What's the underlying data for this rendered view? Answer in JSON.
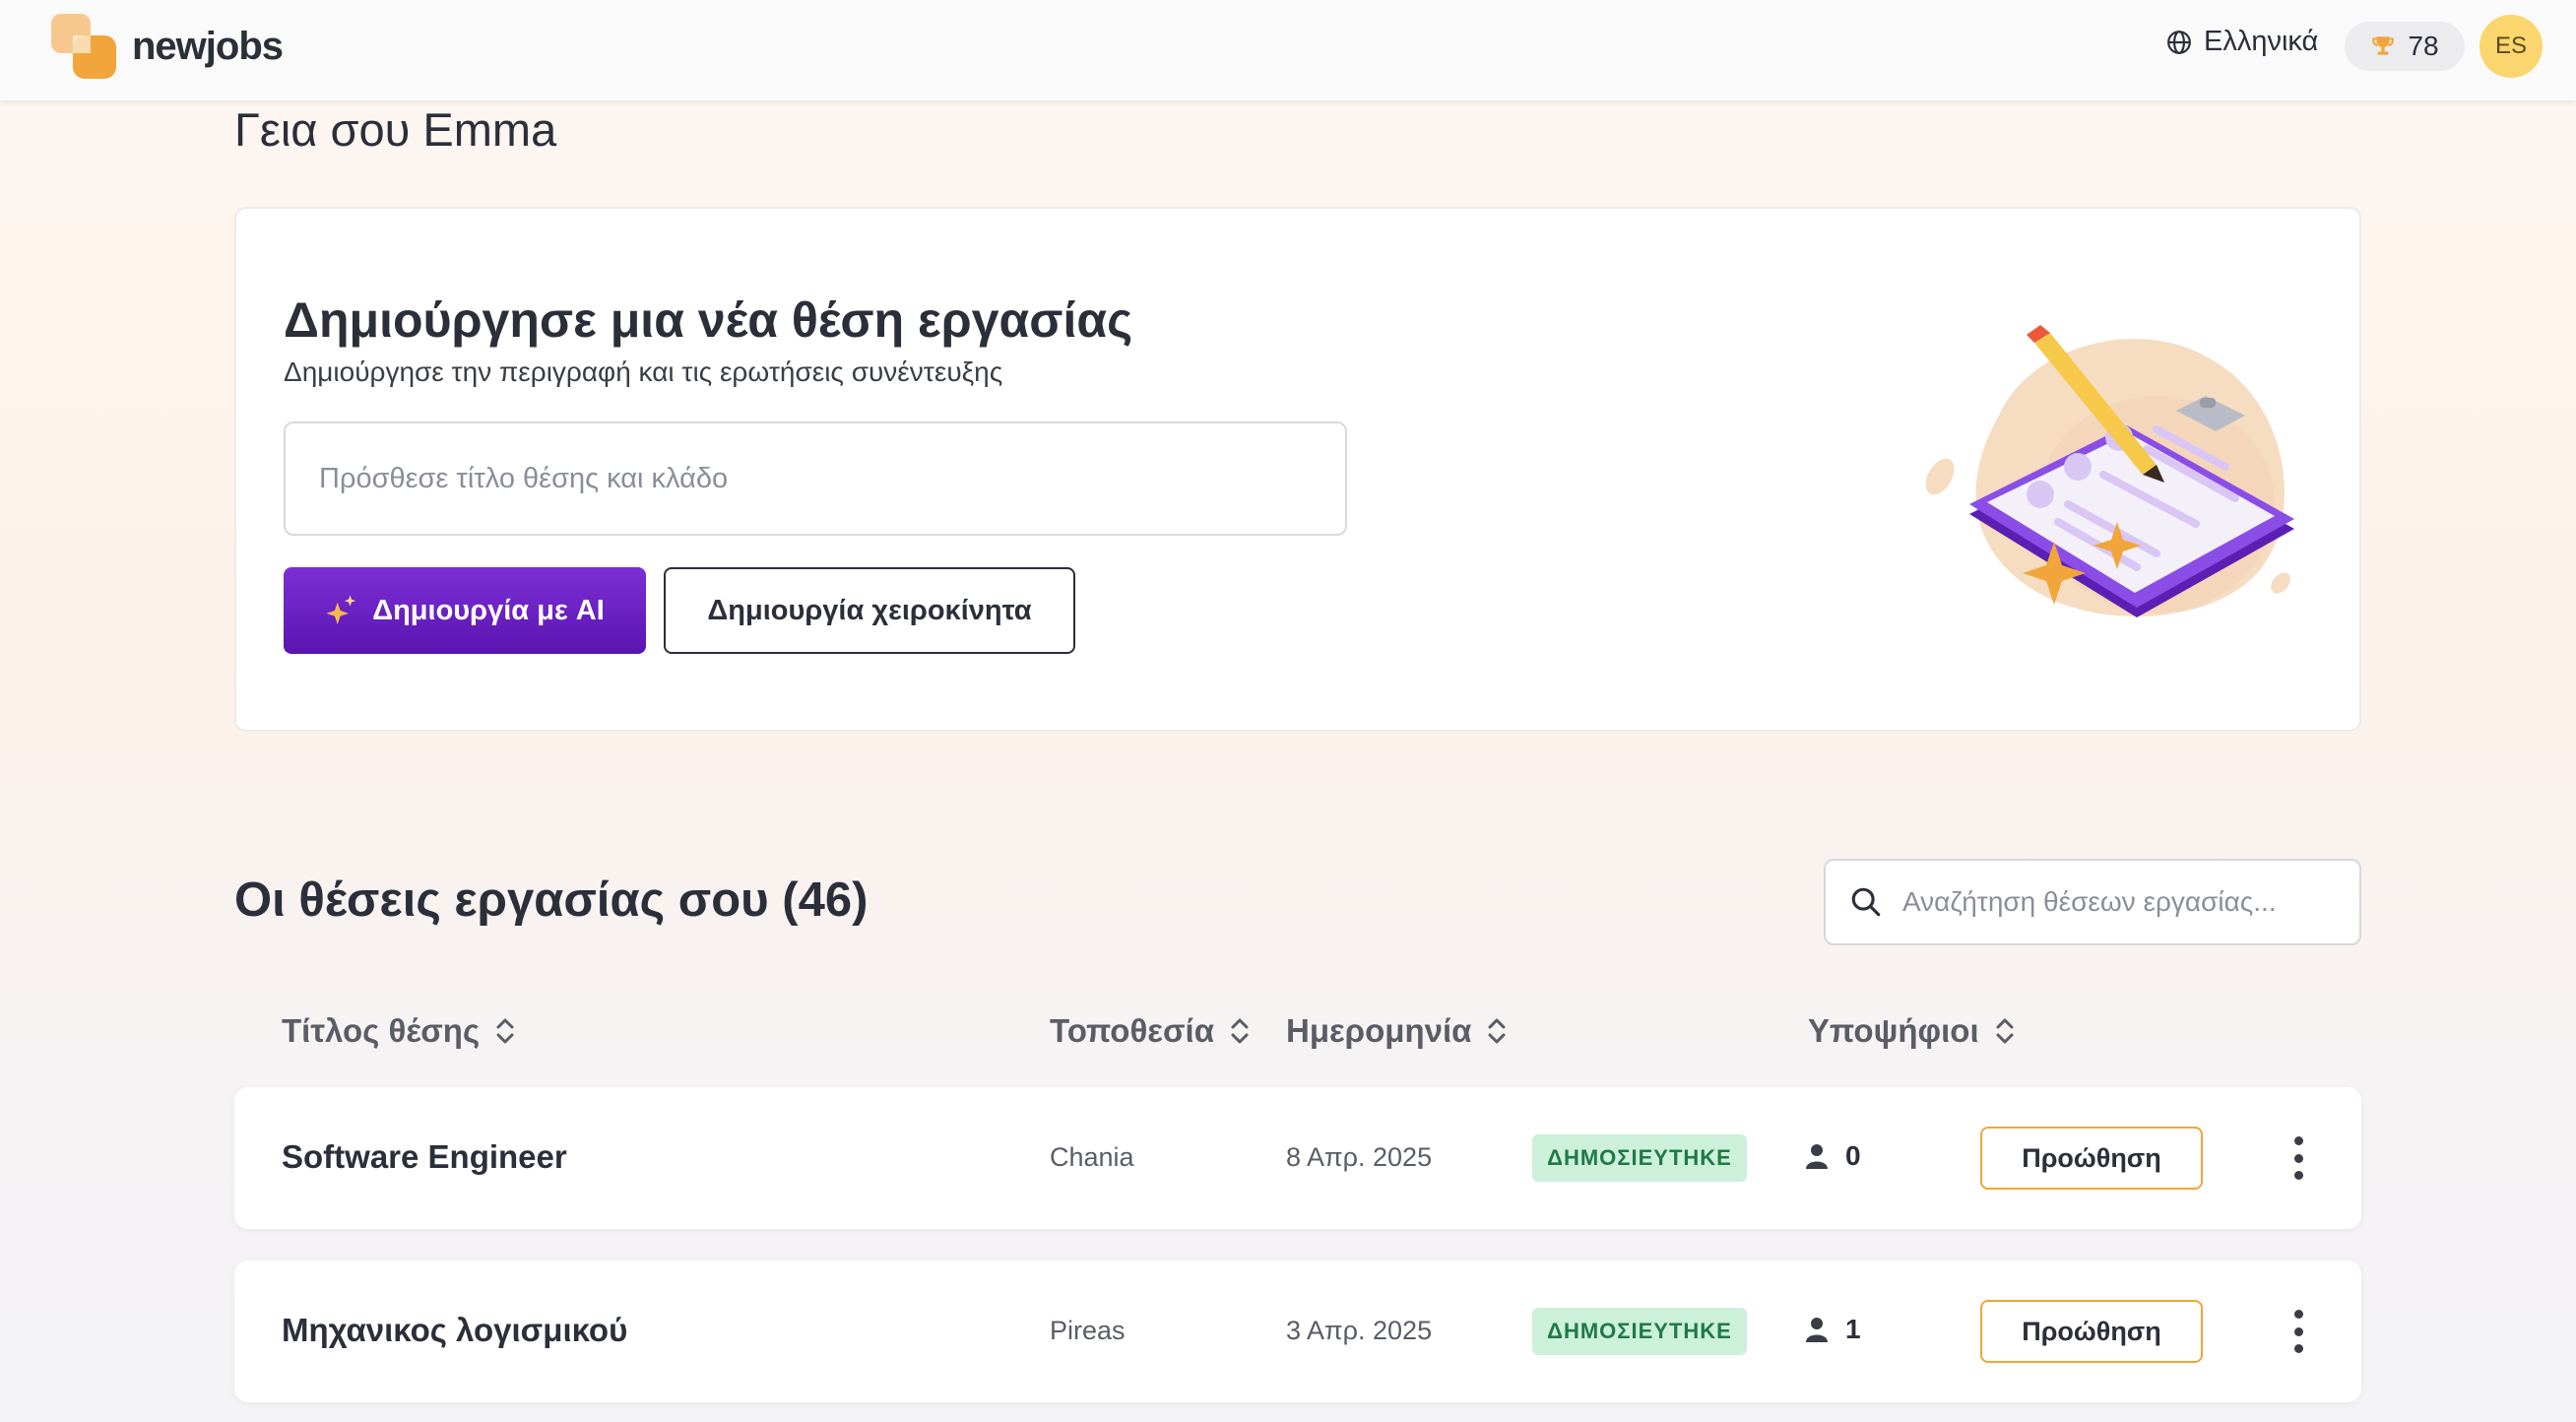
{
  "app": {
    "name": "newjobs",
    "language": "Ελληνικά",
    "points": "78",
    "avatar_initials": "ES"
  },
  "greeting": "Γεια σου Emma",
  "create_job": {
    "title": "Δημιούργησε μια νέα θέση εργασίας",
    "subtitle": "Δημιούργησε την περιγραφή και τις ερωτήσεις συνέντευξης",
    "input_placeholder": "Πρόσθεσε τίτλο θέσης και κλάδο",
    "ai_button_label": "Δημιουργία με AI",
    "manual_button_label": "Δημιουργία χειροκίνητα"
  },
  "jobs": {
    "title": "Οι θέσεις εργασίας σου (46)",
    "search_placeholder": "Αναζήτηση θέσεων εργασίας...",
    "columns": {
      "title": "Τίτλος θέσης",
      "location": "Τοποθεσία",
      "date": "Ημερομηνία",
      "candidates": "Υποψήφιοι"
    },
    "rows": [
      {
        "title": "Software Engineer",
        "location": "Chania",
        "date": "8 Απρ. 2025",
        "status": "ΔΗΜΟΣΙΕΥΤΗΚΕ",
        "candidates": "0",
        "promote_label": "Προώθηση"
      },
      {
        "title": "Μηχανικος λογισμικού",
        "location": "Pireas",
        "date": "3 Απρ. 2025",
        "status": "ΔΗΜΟΣΙΕΥΤΗΚΕ",
        "candidates": "1",
        "promote_label": "Προώθηση"
      }
    ]
  },
  "colors": {
    "brand_orange": "#f2a53a",
    "ai_purple": "#6a1fc4",
    "status_green_bg": "#cdf0da",
    "status_green_text": "#1e7a46",
    "avatar_yellow": "#fbd56d"
  },
  "icons": {
    "logo": "newjobs-logo-icon",
    "language": "globe-icon",
    "points": "trophy-icon",
    "ai": "sparkles-icon",
    "search": "search-icon",
    "sort": "sort-icon",
    "candidates": "user-icon",
    "more": "kebab-menu-icon"
  }
}
